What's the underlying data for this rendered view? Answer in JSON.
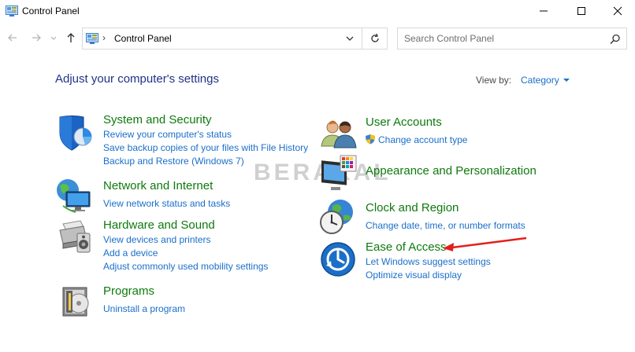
{
  "window": {
    "title": "Control Panel"
  },
  "address": {
    "separator": "›",
    "path": "Control Panel"
  },
  "search": {
    "placeholder": "Search Control Panel"
  },
  "header": {
    "title": "Adjust your computer's settings",
    "view_by_label": "View by:",
    "view_by_value": "Category"
  },
  "categories": {
    "system_security": {
      "title": "System and Security",
      "links": [
        "Review your computer's status",
        "Save backup copies of your files with File History",
        "Backup and Restore (Windows 7)"
      ],
      "icon": "shield-icon"
    },
    "network": {
      "title": "Network and Internet",
      "links": [
        "View network status and tasks"
      ],
      "icon": "network-globe-icon"
    },
    "hardware": {
      "title": "Hardware and Sound",
      "links": [
        "View devices and printers",
        "Add a device",
        "Adjust commonly used mobility settings"
      ],
      "icon": "printer-speaker-icon"
    },
    "programs": {
      "title": "Programs",
      "links": [
        "Uninstall a program"
      ],
      "icon": "programs-disc-icon"
    },
    "user_accounts": {
      "title": "User Accounts",
      "links": [
        "Change account type"
      ],
      "icon": "users-icon"
    },
    "appearance": {
      "title": "Appearance and Personalization",
      "links": [],
      "icon": "monitor-palette-icon"
    },
    "clock": {
      "title": "Clock and Region",
      "links": [
        "Change date, time, or number formats"
      ],
      "icon": "clock-globe-icon"
    },
    "ease": {
      "title": "Ease of Access",
      "links": [
        "Let Windows suggest settings",
        "Optimize visual display"
      ],
      "icon": "ease-of-access-icon"
    }
  },
  "watermark": "BERAKAL",
  "colors": {
    "title_blue": "#1e3287",
    "category_green": "#0e7a0d",
    "link_blue": "#1a6fc9",
    "annotation_red": "#e0201b"
  }
}
